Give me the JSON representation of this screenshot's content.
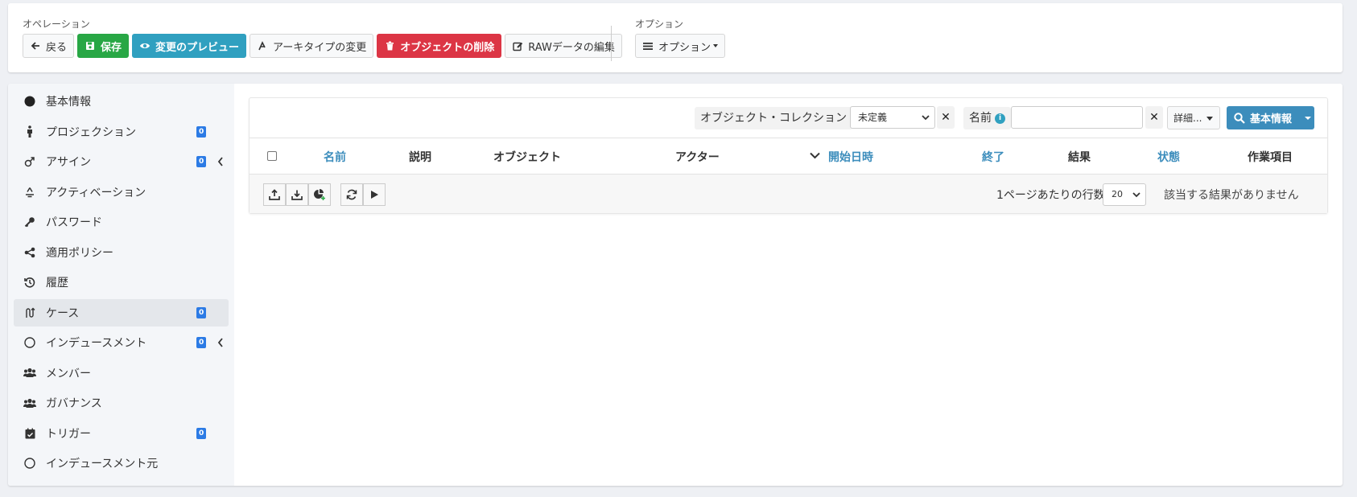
{
  "operations": {
    "label": "オペレーション",
    "buttons": {
      "back": "戻る",
      "save": "保存",
      "preview": "変更のプレビュー",
      "archetype": "アーキタイプの変更",
      "delete": "オブジェクトの削除",
      "raw": "RAWデータの編集"
    }
  },
  "options": {
    "label": "オプション",
    "button": "オプション"
  },
  "sidebar": {
    "items": [
      {
        "label": "基本情報",
        "icon": "circle-solid-icon"
      },
      {
        "label": "プロジェクション",
        "icon": "person-icon",
        "badge": "0"
      },
      {
        "label": "アサイン",
        "icon": "male-sign-icon",
        "badge": "0"
      },
      {
        "label": "アクティベーション",
        "icon": "recycle-icon"
      },
      {
        "label": "パスワード",
        "icon": "key-icon"
      },
      {
        "label": "適用ポリシー",
        "icon": "share-nodes-icon"
      },
      {
        "label": "履歴",
        "icon": "history-icon"
      },
      {
        "label": "ケース",
        "icon": "case-route-icon",
        "badge": "0"
      },
      {
        "label": "インデュースメント",
        "icon": "circle-outline-icon",
        "badge": "0"
      },
      {
        "label": "メンバー",
        "icon": "users-icon"
      },
      {
        "label": "ガバナンス",
        "icon": "users-icon"
      },
      {
        "label": "トリガー",
        "icon": "calendar-check-icon",
        "badge": "0"
      },
      {
        "label": "インデュースメント元",
        "icon": "circle-outline-icon"
      }
    ]
  },
  "search": {
    "collection_label": "オブジェクト・コレクション",
    "collection_value": "未定義",
    "name_label": "名前",
    "name_value": "",
    "advanced": "詳細...",
    "search_button": "基本情報",
    "clear": "✕"
  },
  "table": {
    "headers": {
      "name": "名前",
      "description": "説明",
      "object": "オブジェクト",
      "actor": "アクター",
      "start": "開始日時",
      "end": "終了",
      "result": "結果",
      "state": "状態",
      "work_items": "作業項目"
    },
    "rows_per_page_label": "1ページあたりの行数",
    "rows_per_page": "20",
    "no_results": "該当する結果がありません"
  },
  "colors": {
    "green": "#28a745",
    "teal": "#30a0c0",
    "red": "#dc3545",
    "primary": "#3c8dbc",
    "badge": "#2c7be5"
  }
}
